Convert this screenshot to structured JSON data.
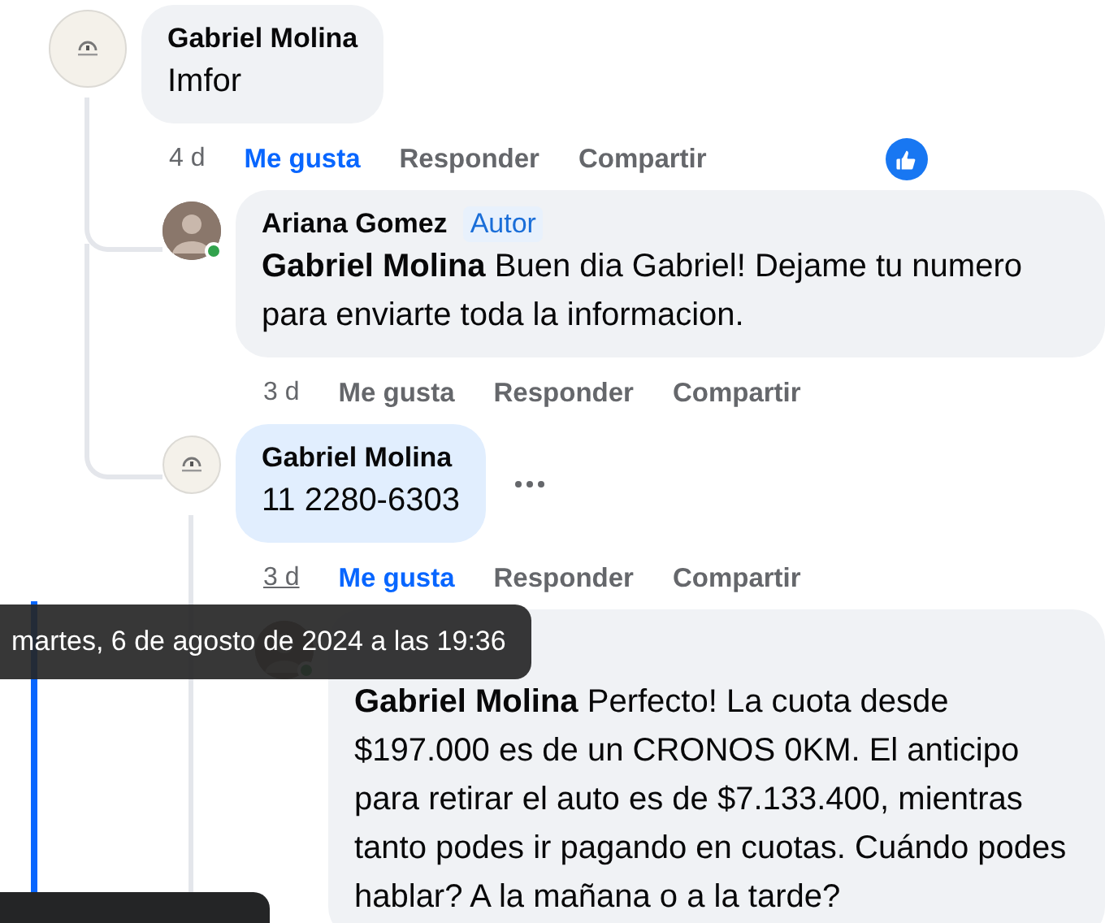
{
  "comments": [
    {
      "author": "Gabriel Molina",
      "avatar": {
        "kind": "logo"
      },
      "online": false,
      "text": "Imfor",
      "highlighted": false,
      "time": "4 d",
      "time_underlined": false,
      "liked": true,
      "actions": [
        "Me gusta",
        "Responder",
        "Compartir"
      ],
      "reaction": {
        "kind": "like"
      },
      "more_menu": false,
      "children": [
        {
          "author": "Ariana Gomez",
          "badge": "Autor",
          "avatar": {
            "kind": "photo"
          },
          "online": true,
          "text": "**Gabriel Molina** Buen dia Gabriel! Dejame tu numero para enviarte toda la informacion.",
          "highlighted": false,
          "time": "3 d",
          "time_underlined": false,
          "liked": false,
          "actions": [
            "Me gusta",
            "Responder",
            "Compartir"
          ],
          "more_menu": false
        },
        {
          "author": "Gabriel Molina",
          "avatar": {
            "kind": "logo"
          },
          "online": false,
          "text": "11 2280-6303",
          "highlighted": true,
          "time": "3 d",
          "time_underlined": true,
          "liked": true,
          "actions": [
            "Me gusta",
            "Responder",
            "Compartir"
          ],
          "more_menu": true,
          "children": [
            {
              "avatar": {
                "kind": "photo"
              },
              "online": true,
              "text": "**Gabriel Molina** Perfecto! La cuota desde $197.000 es de un CRONOS 0KM. El anticipo para retirar el auto es de $7.133.400, mientras tanto podes ir pagando en cuotas. Cuándo podes hablar? A la mañana o a la tarde?",
              "highlighted": false,
              "more_menu": false
            }
          ]
        }
      ]
    }
  ],
  "tooltip": {
    "text": "martes, 6 de agosto de 2024 a las 19:36"
  }
}
